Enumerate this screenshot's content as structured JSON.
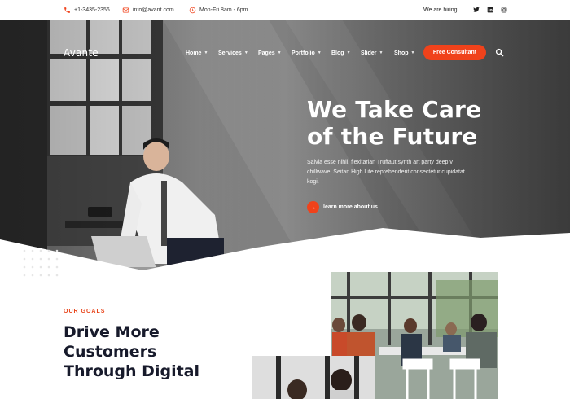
{
  "topbar": {
    "phone": "+1-3435-2356",
    "email": "info@avant.com",
    "hours": "Mon-Fri 8am - 6pm",
    "hiring": "We are hiring!",
    "social": [
      "twitter-icon",
      "linkedin-icon",
      "instagram-icon"
    ]
  },
  "header": {
    "logo": "Avante",
    "nav": [
      {
        "label": "Home"
      },
      {
        "label": "Services"
      },
      {
        "label": "Pages"
      },
      {
        "label": "Portfolio"
      },
      {
        "label": "Blog"
      },
      {
        "label": "Slider"
      },
      {
        "label": "Shop"
      }
    ],
    "cta": "Free Consultant",
    "search_icon": "search-icon"
  },
  "hero": {
    "title_line1": "We Take Care",
    "title_line2": "of the Future",
    "desc": "Salvia esse nihil, flexitarian Truffaut synth art party deep v chillwave. Seitan High Life reprehenderit consectetur cupidatat kogi.",
    "learn_more": "learn more about us"
  },
  "goals": {
    "label": "OUR GOALS",
    "title_line1": "Drive More",
    "title_line2": "Customers",
    "title_line3": "Through Digital"
  },
  "colors": {
    "accent": "#f0421b",
    "heading": "#171a2b"
  }
}
